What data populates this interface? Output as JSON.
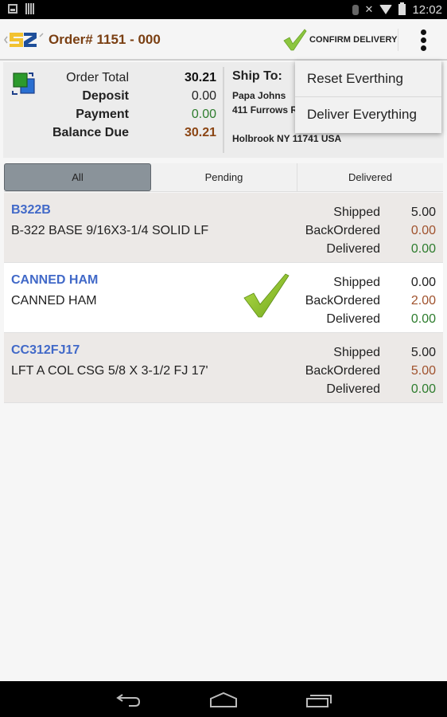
{
  "status_bar": {
    "time": "12:02",
    "icons": [
      "image-notification-icon",
      "barcode-notification-icon",
      "bluetooth-icon",
      "mute-icon",
      "wifi-icon",
      "battery-charging-icon"
    ]
  },
  "action_bar": {
    "title": "Order# 1151 - 000",
    "confirm_label": "CONFIRM DELIVERY",
    "overflow_icon": "more-vert-icon",
    "brand_color": "#7a3f12"
  },
  "summary": {
    "rows": [
      {
        "label": "Order Total",
        "value": "30.21"
      },
      {
        "label": "Deposit",
        "value": "0.00"
      },
      {
        "label": "Payment",
        "value": "0.00"
      },
      {
        "label": "Balance Due",
        "value": "30.21"
      }
    ],
    "ship_to": {
      "title": "Ship To:",
      "name": "Papa Johns",
      "address": "411 Furrows R",
      "city": "Holbrook NY 11741 USA"
    }
  },
  "popup_menu": {
    "items": [
      "Reset Everthing",
      "Deliver Everything"
    ]
  },
  "tabs": [
    {
      "label": "All",
      "active": true
    },
    {
      "label": "Pending",
      "active": false
    },
    {
      "label": "Delivered",
      "active": false
    }
  ],
  "items": [
    {
      "code": "B322B",
      "desc": "B-322 BASE 9/16X3-1/4 SOLID LF",
      "delivered_check": false,
      "labels": {
        "shipped": "Shipped",
        "back": "BackOrdered",
        "delivered": "Delivered"
      },
      "shipped": "5.00",
      "backordered": "0.00",
      "delivered": "0.00"
    },
    {
      "code": "CANNED HAM",
      "desc": "CANNED HAM",
      "delivered_check": true,
      "labels": {
        "shipped": "Shipped",
        "back": "BackOrdered",
        "delivered": "Delivered"
      },
      "shipped": "0.00",
      "backordered": "2.00",
      "delivered": "0.00"
    },
    {
      "code": "CC312FJ17",
      "desc": "LFT A COL CSG 5/8 X 3-1/2 FJ 17'",
      "delivered_check": false,
      "labels": {
        "shipped": "Shipped",
        "back": "BackOrdered",
        "delivered": "Delivered"
      },
      "shipped": "5.00",
      "backordered": "5.00",
      "delivered": "0.00"
    }
  ],
  "colors": {
    "code_link": "#4169c8",
    "backordered": "#a0522d",
    "delivered": "#2e7d2e",
    "balance_due": "#8b4513"
  }
}
